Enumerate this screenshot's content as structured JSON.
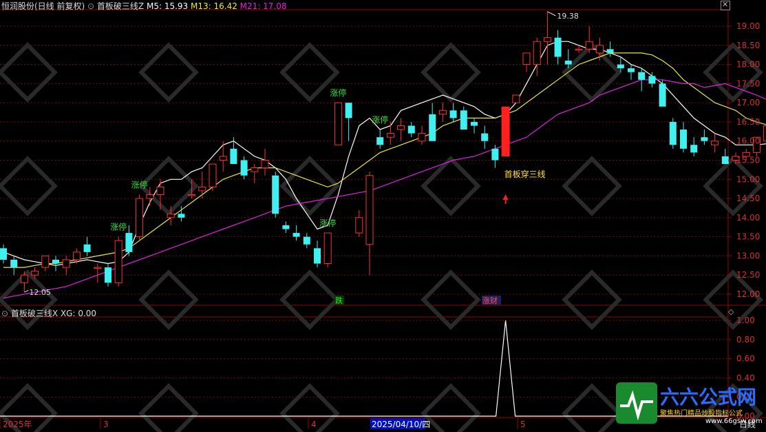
{
  "header": {
    "stock": "恒润股份(日线 前复权)",
    "indicator": "首板破三线Z",
    "m5": "M5: 15.93",
    "m13": "M13: 16.42",
    "m21": "M21: 17.08",
    "sub_title": "首板破三线X",
    "sub_value": "XG: 0.00"
  },
  "colors": {
    "m5": "#ffffff",
    "m13": "#e8e840",
    "m21": "#e020e0",
    "up": "#ff3030",
    "down": "#40f0f0",
    "signal": "#ff2020"
  },
  "labels": {
    "limit_up": "涨停",
    "signal": "首板穿三线",
    "high": "19.38",
    "low": "12.05",
    "tag_fall": "跌",
    "tag_rise": "涨财",
    "period": "日线"
  },
  "xaxis": {
    "year": "2025年",
    "m3": "3",
    "m4": "4",
    "m5": "5",
    "cursor_date": "2025/04/10/四"
  },
  "watermark": {
    "name": "六六公式网",
    "tagline": "聚焦热门精品炒股指标公式",
    "url": "www.66gsw.com"
  },
  "chart_data": [
    {
      "type": "candlestick",
      "ylim": [
        11.9,
        19.4
      ],
      "yticks": [
        12.0,
        12.5,
        13.0,
        13.5,
        14.0,
        14.5,
        15.0,
        15.5,
        16.0,
        16.5,
        17.0,
        17.5,
        18.0,
        18.5,
        19.0
      ],
      "candles": [
        [
          13.2,
          13.3,
          12.8,
          12.9
        ],
        [
          12.9,
          13.0,
          12.5,
          12.7
        ],
        [
          12.3,
          12.6,
          12.05,
          12.5
        ],
        [
          12.5,
          12.7,
          12.4,
          12.6
        ],
        [
          12.7,
          13.0,
          12.6,
          13.0
        ],
        [
          12.9,
          13.0,
          12.6,
          12.8
        ],
        [
          12.7,
          13.0,
          12.5,
          12.9
        ],
        [
          12.9,
          13.2,
          12.8,
          13.1
        ],
        [
          13.3,
          13.5,
          13.0,
          13.1
        ],
        [
          12.7,
          12.8,
          12.3,
          12.7
        ],
        [
          12.7,
          12.8,
          12.2,
          12.3
        ],
        [
          12.3,
          13.5,
          12.2,
          13.4
        ],
        [
          13.6,
          13.8,
          13.0,
          13.1
        ],
        [
          13.5,
          14.6,
          13.4,
          14.5
        ],
        [
          14.5,
          14.8,
          14.3,
          14.6
        ],
        [
          14.6,
          15.0,
          14.2,
          14.8
        ],
        [
          14.0,
          14.3,
          13.8,
          14.1
        ],
        [
          14.1,
          14.3,
          13.9,
          14.0
        ],
        [
          14.6,
          15.0,
          14.5,
          14.6
        ],
        [
          14.7,
          15.2,
          14.5,
          14.8
        ],
        [
          14.8,
          15.4,
          14.7,
          15.4
        ],
        [
          15.5,
          16.0,
          15.2,
          15.6
        ],
        [
          15.8,
          16.1,
          15.4,
          15.4
        ],
        [
          15.5,
          15.6,
          15.0,
          15.1
        ],
        [
          15.2,
          15.4,
          14.9,
          15.3
        ],
        [
          15.3,
          15.8,
          15.1,
          15.5
        ],
        [
          15.1,
          15.2,
          14.0,
          14.1
        ],
        [
          13.8,
          13.9,
          13.6,
          13.7
        ],
        [
          13.6,
          13.8,
          13.4,
          13.5
        ],
        [
          13.5,
          13.6,
          13.2,
          13.3
        ],
        [
          13.2,
          13.4,
          12.7,
          12.8
        ],
        [
          12.8,
          13.6,
          12.7,
          13.6
        ],
        [
          15.9,
          17.0,
          15.9,
          17.0
        ],
        [
          17.0,
          17.0,
          16.0,
          16.6
        ],
        [
          13.6,
          14.2,
          13.5,
          14.0
        ],
        [
          13.3,
          15.2,
          12.5,
          15.1
        ],
        [
          16.1,
          16.3,
          15.8,
          15.9
        ],
        [
          16.1,
          16.5,
          15.9,
          16.2
        ],
        [
          16.3,
          16.6,
          16.0,
          16.4
        ],
        [
          16.4,
          16.5,
          16.1,
          16.2
        ],
        [
          16.0,
          16.4,
          15.9,
          16.2
        ],
        [
          16.7,
          17.0,
          16.0,
          16.0
        ],
        [
          16.7,
          17.0,
          16.5,
          16.8
        ],
        [
          16.8,
          17.0,
          16.5,
          16.6
        ],
        [
          16.8,
          16.9,
          16.4,
          16.3
        ],
        [
          16.5,
          16.6,
          16.2,
          16.4
        ],
        [
          16.2,
          16.4,
          15.8,
          16.0
        ],
        [
          15.8,
          15.9,
          15.3,
          15.5
        ],
        [
          15.6,
          16.9,
          15.6,
          16.9
        ],
        [
          17.0,
          17.2,
          17.0,
          17.2
        ],
        [
          18.0,
          18.2,
          17.8,
          18.3
        ],
        [
          18.0,
          18.7,
          17.7,
          18.6
        ],
        [
          18.6,
          19.38,
          18.0,
          18.7
        ],
        [
          18.7,
          18.9,
          18.0,
          18.2
        ],
        [
          18.1,
          18.4,
          17.9,
          18.0
        ],
        [
          18.4,
          18.5,
          18.3,
          18.4
        ],
        [
          18.4,
          19.0,
          18.3,
          18.6
        ],
        [
          18.3,
          18.7,
          18.1,
          18.5
        ],
        [
          18.4,
          18.6,
          18.2,
          18.3
        ],
        [
          18.0,
          18.2,
          17.8,
          17.9
        ],
        [
          17.9,
          18.0,
          17.6,
          17.8
        ],
        [
          17.8,
          17.9,
          17.3,
          17.6
        ],
        [
          17.7,
          17.8,
          17.4,
          17.5
        ],
        [
          17.5,
          17.6,
          17.0,
          16.9
        ],
        [
          16.5,
          16.6,
          15.8,
          15.9
        ],
        [
          16.3,
          16.5,
          15.7,
          15.8
        ],
        [
          15.9,
          16.1,
          15.6,
          15.7
        ],
        [
          16.1,
          16.3,
          15.9,
          16.0
        ],
        [
          15.9,
          16.2,
          15.7,
          16.0
        ],
        [
          15.6,
          15.8,
          15.4,
          15.4
        ],
        [
          15.5,
          15.7,
          15.4,
          15.6
        ],
        [
          15.6,
          15.8,
          15.5,
          15.7
        ],
        [
          15.7,
          16.1,
          15.6,
          16.1
        ],
        [
          16.0,
          16.3,
          15.8,
          16.4
        ]
      ],
      "series": [
        {
          "name": "M5",
          "values": [
            13.1,
            13.0,
            12.9,
            12.85,
            12.8,
            12.75,
            12.8,
            12.85,
            12.9,
            12.85,
            12.8,
            12.85,
            13.1,
            13.8,
            14.4,
            14.9,
            15.0,
            15.0,
            15.2,
            15.3,
            15.6,
            15.9,
            16.0,
            15.8,
            15.6,
            15.5,
            15.3,
            15.0,
            14.5,
            14.1,
            13.7,
            13.8,
            14.6,
            15.6,
            16.4,
            16.6,
            16.3,
            16.4,
            16.8,
            16.9,
            17.0,
            17.1,
            17.2,
            17.1,
            17.0,
            16.9,
            16.7,
            16.6,
            16.7,
            17.0,
            17.5,
            18.0,
            18.5,
            18.6,
            18.6,
            18.5,
            18.4,
            18.4,
            18.3,
            18.2,
            18.0,
            17.9,
            17.7,
            17.5,
            17.2,
            16.9,
            16.6,
            16.4,
            16.2,
            16.1,
            15.9,
            15.9,
            15.9,
            15.93
          ]
        },
        {
          "name": "M13",
          "values": [
            12.7,
            12.7,
            12.7,
            12.75,
            12.8,
            12.8,
            12.85,
            12.9,
            12.95,
            13.0,
            13.05,
            13.1,
            13.2,
            13.4,
            13.6,
            13.8,
            14.0,
            14.2,
            14.4,
            14.6,
            14.8,
            15.0,
            15.1,
            15.2,
            15.3,
            15.3,
            15.3,
            15.2,
            15.1,
            15.0,
            14.9,
            14.8,
            14.9,
            15.1,
            15.3,
            15.5,
            15.7,
            15.8,
            15.9,
            16.0,
            16.1,
            16.2,
            16.4,
            16.5,
            16.6,
            16.6,
            16.6,
            16.6,
            16.7,
            16.8,
            17.0,
            17.2,
            17.4,
            17.6,
            17.8,
            18.0,
            18.1,
            18.2,
            18.3,
            18.3,
            18.3,
            18.3,
            18.25,
            18.1,
            17.9,
            17.6,
            17.4,
            17.2,
            17.0,
            16.9,
            16.8,
            16.6,
            16.5,
            16.42
          ]
        },
        {
          "name": "M21",
          "values": [
            11.9,
            11.95,
            12.0,
            12.05,
            12.1,
            12.15,
            12.2,
            12.3,
            12.4,
            12.5,
            12.6,
            12.7,
            12.8,
            12.9,
            13.0,
            13.1,
            13.2,
            13.3,
            13.4,
            13.5,
            13.6,
            13.7,
            13.8,
            13.9,
            14.0,
            14.1,
            14.2,
            14.3,
            14.35,
            14.4,
            14.45,
            14.5,
            14.55,
            14.6,
            14.65,
            14.7,
            14.8,
            14.9,
            15.0,
            15.1,
            15.2,
            15.3,
            15.4,
            15.5,
            15.55,
            15.6,
            15.7,
            15.8,
            15.9,
            16.0,
            16.1,
            16.3,
            16.5,
            16.7,
            16.8,
            16.9,
            17.0,
            17.2,
            17.3,
            17.4,
            17.5,
            17.6,
            17.6,
            17.6,
            17.55,
            17.5,
            17.5,
            17.4,
            17.45,
            17.5,
            17.4,
            17.3,
            17.2,
            17.08
          ]
        }
      ],
      "limit_up_markers": [
        11,
        13,
        31,
        32,
        36,
        48
      ],
      "signal_index": 48,
      "high_label": {
        "index": 52,
        "value": 19.38
      },
      "low_label": {
        "index": 2,
        "value": 12.05
      }
    },
    {
      "type": "line",
      "ylim": [
        0,
        1.05
      ],
      "yticks": [
        0.0,
        0.2,
        0.4,
        0.6,
        0.8,
        1.0
      ],
      "spike_index": 48,
      "spike_value": 1.0
    }
  ]
}
